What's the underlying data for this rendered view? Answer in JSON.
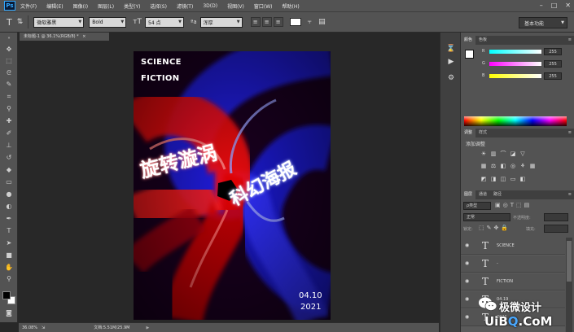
{
  "app": {
    "logo": "Ps",
    "menu": [
      "文件(F)",
      "编辑(E)",
      "图像(I)",
      "图层(L)",
      "类型(Y)",
      "选择(S)",
      "滤镜(T)",
      "3D(D)",
      "视图(V)",
      "窗口(W)",
      "帮助(H)"
    ]
  },
  "options_bar": {
    "font_family": "微软雅黑",
    "font_style": "Bold",
    "font_size": "54 点",
    "antialias": "浑厚",
    "workspace": "基本功能"
  },
  "document": {
    "tab_title": "未标题-1 @ 36.1%(RGB/8) *",
    "zoom": "36.08%",
    "doc_size": "文档:5.51M/25.9M"
  },
  "poster": {
    "line1": "SCIENCE",
    "line2": "FICTION",
    "title_cn_1": "旋转漩涡",
    "title_cn_2": "科幻海报",
    "date": "04.10",
    "year": "2021",
    "colors": {
      "red": "#ff1010",
      "blue": "#2a2aff",
      "dark": "#120010"
    }
  },
  "color_panel": {
    "tabs": [
      "颜色",
      "色板"
    ],
    "r": {
      "label": "R",
      "value": "255"
    },
    "g": {
      "label": "G",
      "value": "255"
    },
    "b": {
      "label": "B",
      "value": "255"
    }
  },
  "adjustments_panel": {
    "tabs": [
      "调整",
      "样式"
    ],
    "title": "添加调整"
  },
  "layers_panel": {
    "tabs": [
      "图层",
      "通道",
      "路径"
    ],
    "kind_filter": "ρ类型",
    "blend_mode": "正常",
    "opacity_label": "不透明度:",
    "lock_label": "锁定:",
    "fill_label": "填充:",
    "layers": [
      {
        "name": "SCIENCE",
        "type": "T"
      },
      {
        "name": "-",
        "type": "T"
      },
      {
        "name": "FICTION",
        "type": "T"
      },
      {
        "name": "04.19",
        "type": "T"
      },
      {
        "name": "2021",
        "type": "T"
      }
    ]
  },
  "watermark": {
    "name": "极微设计",
    "site_pre": "Ui",
    "site_b": "B",
    "site_o": "Q",
    "site_post": ".CoM"
  }
}
